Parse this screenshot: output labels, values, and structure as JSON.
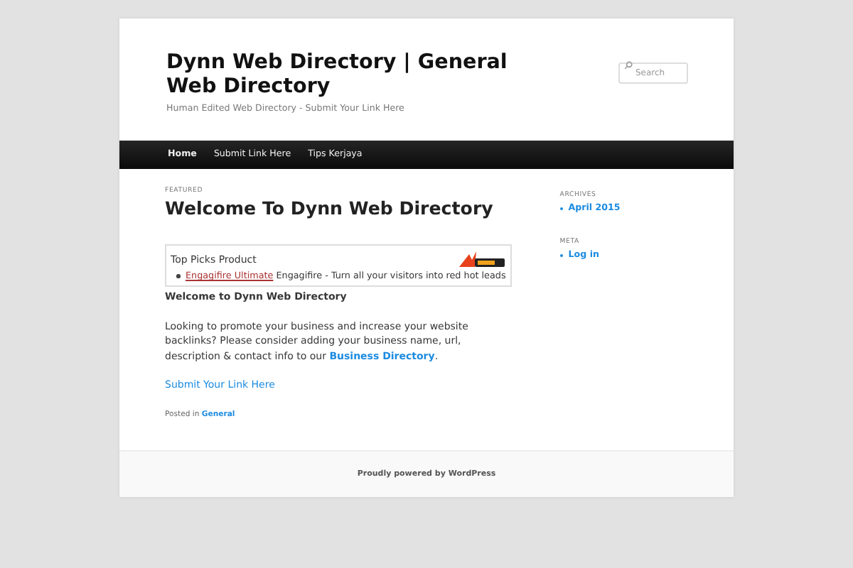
{
  "site": {
    "title": "Dynn Web Directory | General Web Directory",
    "tagline": "Human Edited Web Directory - Submit Your Link Here"
  },
  "search": {
    "placeholder": "Search"
  },
  "nav": [
    {
      "label": "Home",
      "selected": true
    },
    {
      "label": "Submit Link Here",
      "selected": false
    },
    {
      "label": "Tips Kerjaya",
      "selected": false
    }
  ],
  "post": {
    "label": "FEATURED",
    "title": "Welcome To Dynn Web Directory",
    "widget": {
      "heading": "Top Picks Product",
      "items": [
        {
          "link": "Engagifire Ultimate",
          "text": "Engagifire - Turn all your visitors into red hot leads"
        }
      ]
    },
    "intro": "Welcome to Dynn Web Directory",
    "body": "Looking to promote your business and increase your website backlinks? Please consider adding your business name, url, description & contact info to our",
    "body_link": "Business Directory",
    "body_end": ".",
    "submit_link": "Submit Your Link Here",
    "posted_in": "Posted in",
    "category": "General"
  },
  "sidebar": [
    {
      "heading": "ARCHIVES",
      "items": [
        "April 2015"
      ]
    },
    {
      "heading": "META",
      "items": [
        "Log in"
      ]
    }
  ],
  "footer": "Proudly powered by WordPress"
}
